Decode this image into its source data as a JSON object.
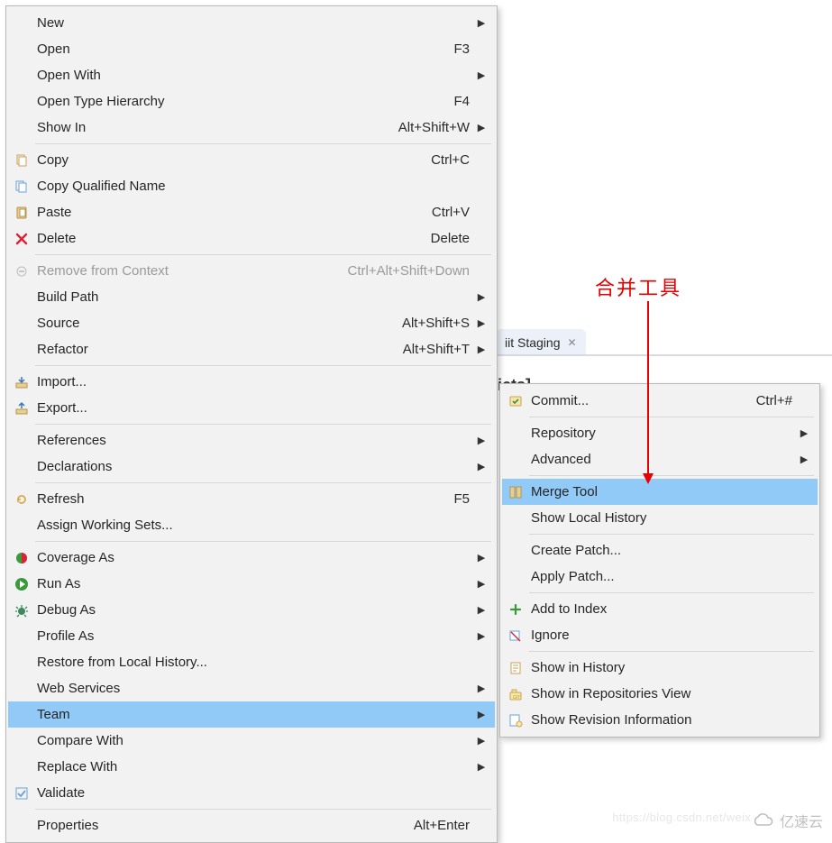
{
  "bgTab": {
    "label": "Git Staging",
    "partialText": "iit Staging",
    "rightFragment": "icts]"
  },
  "annotation": {
    "label": "合并工具"
  },
  "watermark": {
    "text": "亿速云",
    "url": "https://blog.csdn.net/weix"
  },
  "mainMenu": [
    {
      "icon": null,
      "label": "New",
      "shortcut": "",
      "submenu": true
    },
    {
      "icon": null,
      "label": "Open",
      "shortcut": "F3"
    },
    {
      "icon": null,
      "label": "Open With",
      "shortcut": "",
      "submenu": true
    },
    {
      "icon": null,
      "label": "Open Type Hierarchy",
      "shortcut": "F4"
    },
    {
      "icon": null,
      "label": "Show In",
      "shortcut": "Alt+Shift+W",
      "submenu": true
    },
    {
      "sep": true
    },
    {
      "icon": "copy",
      "label": "Copy",
      "shortcut": "Ctrl+C"
    },
    {
      "icon": "copy-qualified",
      "label": "Copy Qualified Name",
      "shortcut": ""
    },
    {
      "icon": "paste",
      "label": "Paste",
      "shortcut": "Ctrl+V"
    },
    {
      "icon": "delete",
      "label": "Delete",
      "shortcut": "Delete"
    },
    {
      "sep": true
    },
    {
      "icon": "remove-context",
      "label": "Remove from Context",
      "shortcut": "Ctrl+Alt+Shift+Down",
      "disabled": true
    },
    {
      "icon": null,
      "label": "Build Path",
      "shortcut": "",
      "submenu": true
    },
    {
      "icon": null,
      "label": "Source",
      "shortcut": "Alt+Shift+S",
      "submenu": true
    },
    {
      "icon": null,
      "label": "Refactor",
      "shortcut": "Alt+Shift+T",
      "submenu": true
    },
    {
      "sep": true
    },
    {
      "icon": "import",
      "label": "Import...",
      "shortcut": ""
    },
    {
      "icon": "export",
      "label": "Export...",
      "shortcut": ""
    },
    {
      "sep": true
    },
    {
      "icon": null,
      "label": "References",
      "shortcut": "",
      "submenu": true
    },
    {
      "icon": null,
      "label": "Declarations",
      "shortcut": "",
      "submenu": true
    },
    {
      "sep": true
    },
    {
      "icon": "refresh",
      "label": "Refresh",
      "shortcut": "F5"
    },
    {
      "icon": null,
      "label": "Assign Working Sets...",
      "shortcut": ""
    },
    {
      "sep": true
    },
    {
      "icon": "coverage",
      "label": "Coverage As",
      "shortcut": "",
      "submenu": true
    },
    {
      "icon": "run",
      "label": "Run As",
      "shortcut": "",
      "submenu": true
    },
    {
      "icon": "debug",
      "label": "Debug As",
      "shortcut": "",
      "submenu": true
    },
    {
      "icon": null,
      "label": "Profile As",
      "shortcut": "",
      "submenu": true
    },
    {
      "icon": null,
      "label": "Restore from Local History...",
      "shortcut": ""
    },
    {
      "icon": null,
      "label": "Web Services",
      "shortcut": "",
      "submenu": true
    },
    {
      "icon": null,
      "label": "Team",
      "shortcut": "",
      "submenu": true,
      "highlight": true
    },
    {
      "icon": null,
      "label": "Compare With",
      "shortcut": "",
      "submenu": true
    },
    {
      "icon": null,
      "label": "Replace With",
      "shortcut": "",
      "submenu": true
    },
    {
      "icon": "validate",
      "label": "Validate",
      "shortcut": ""
    },
    {
      "sep": true
    },
    {
      "icon": null,
      "label": "Properties",
      "shortcut": "Alt+Enter"
    }
  ],
  "subMenu": [
    {
      "icon": "commit",
      "label": "Commit...",
      "shortcut": "Ctrl+#"
    },
    {
      "sep": true
    },
    {
      "icon": null,
      "label": "Repository",
      "shortcut": "",
      "submenu": true
    },
    {
      "icon": null,
      "label": "Advanced",
      "shortcut": "",
      "submenu": true
    },
    {
      "sep": true
    },
    {
      "icon": "merge-tool",
      "label": "Merge Tool",
      "shortcut": "",
      "highlight": true
    },
    {
      "icon": null,
      "label": "Show Local History",
      "shortcut": ""
    },
    {
      "sep": true
    },
    {
      "icon": null,
      "label": "Create Patch...",
      "shortcut": ""
    },
    {
      "icon": null,
      "label": "Apply Patch...",
      "shortcut": ""
    },
    {
      "sep": true
    },
    {
      "icon": "add-index",
      "label": "Add to Index",
      "shortcut": ""
    },
    {
      "icon": "ignore",
      "label": "Ignore",
      "shortcut": ""
    },
    {
      "sep": true
    },
    {
      "icon": "history",
      "label": "Show in History",
      "shortcut": ""
    },
    {
      "icon": "repo-view",
      "label": "Show in Repositories View",
      "shortcut": ""
    },
    {
      "icon": "revision",
      "label": "Show Revision Information",
      "shortcut": ""
    }
  ]
}
